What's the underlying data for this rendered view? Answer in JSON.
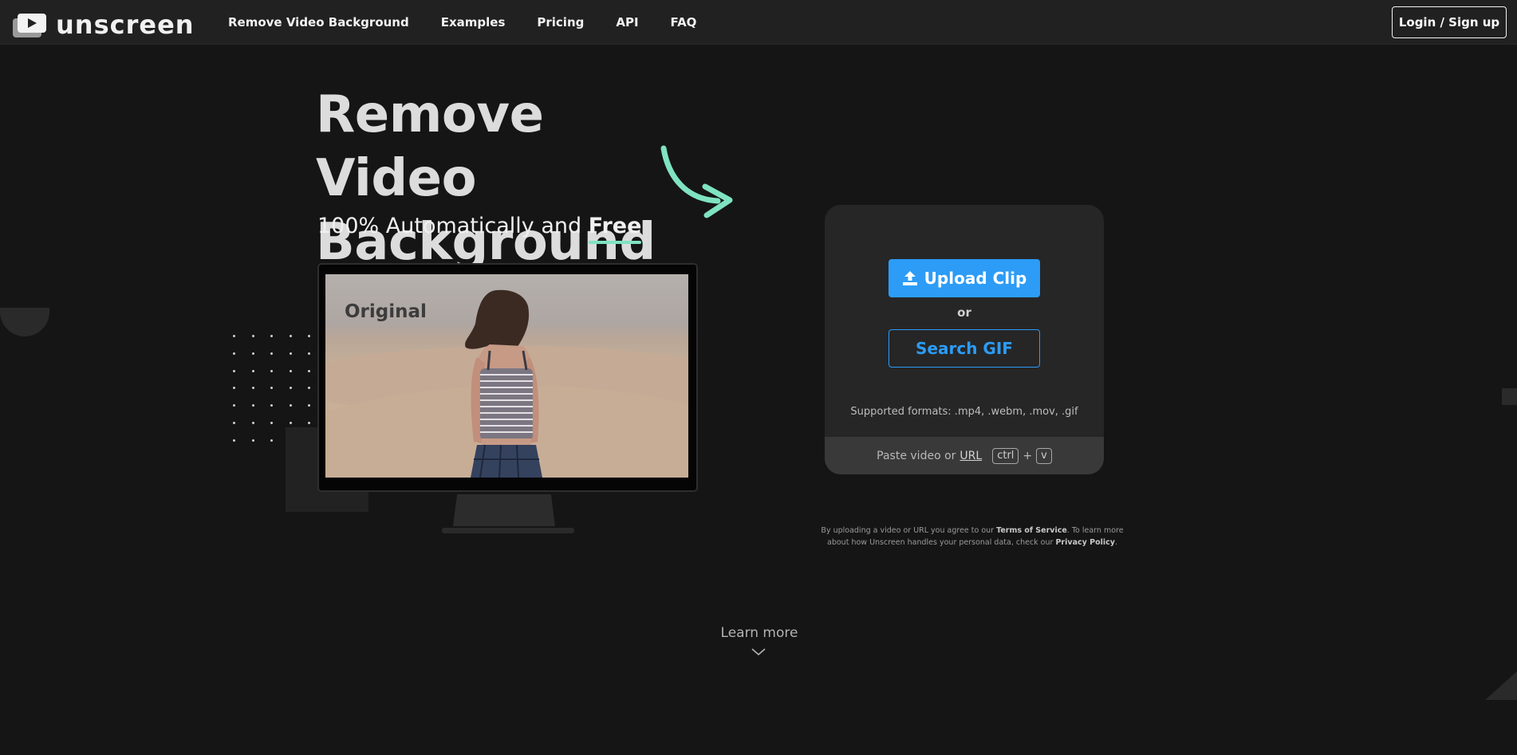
{
  "nav": {
    "logo_text": "unscreen",
    "links": [
      "Remove Video Background",
      "Examples",
      "Pricing",
      "API",
      "FAQ"
    ],
    "login_label": "Login / Sign up"
  },
  "hero": {
    "title_line1": "Remove Video",
    "title_line2": "Background",
    "subtitle_prefix": "100% Automatically and",
    "subtitle_highlight": "Free",
    "screen_label": "Original"
  },
  "upload": {
    "upload_label": "Upload Clip",
    "or_label": "or",
    "search_gif_label": "Search GIF",
    "formats_text": "Supported formats: .mp4, .webm, .mov, .gif",
    "paste_prefix": "Paste video or",
    "paste_url": "URL",
    "key_ctrl": "ctrl",
    "key_plus": "+",
    "key_v": "v"
  },
  "legal": {
    "part1": "By uploading a video or URL you agree to our",
    "terms": "Terms of Service",
    "part2": ". To learn more about how Unscreen handles your personal data, check our",
    "privacy": "Privacy Policy",
    "part3": "."
  },
  "learn_more": "Learn more",
  "colors": {
    "background": "#151516",
    "nav": "#212122",
    "accent_blue": "#2c9cf7",
    "accent_mint": "#7fe3c0",
    "card": "#262627"
  },
  "icons": [
    "play-icon",
    "upload-icon",
    "curved-arrow-icon",
    "chevron-down-icon"
  ]
}
